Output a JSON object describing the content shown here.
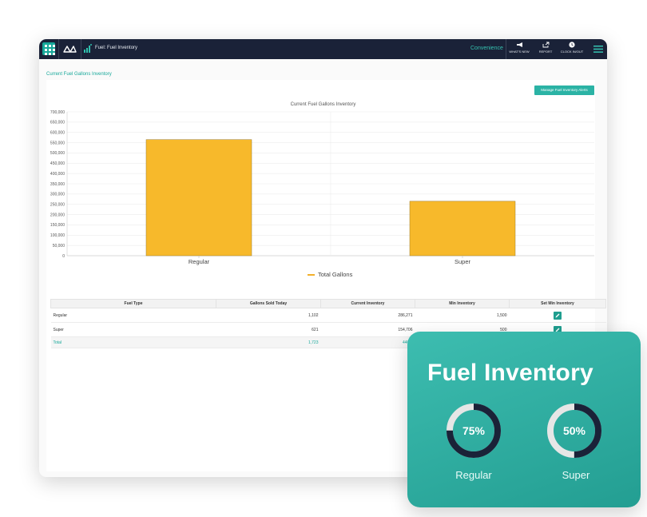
{
  "topbar": {
    "breadcrumb": "Fuel: Fuel Inventory",
    "store_name": "Convenience",
    "buttons": [
      {
        "label": "WHAT'S NEW",
        "icon": "megaphone-icon"
      },
      {
        "label": "REPORT",
        "icon": "report-share-icon"
      },
      {
        "label": "CLOCK IN/OUT",
        "icon": "clock-icon"
      }
    ]
  },
  "page": {
    "heading": "Current Fuel Gallons Inventory",
    "alert_button": "Manage Fuel Inventory Alerts"
  },
  "chart_data": {
    "type": "bar",
    "title": "Current Fuel Gallons Inventory",
    "categories": [
      "Regular",
      "Super"
    ],
    "series": [
      {
        "name": "Total Gallons",
        "values": [
          565000,
          265000
        ]
      }
    ],
    "ylim": [
      0,
      700000
    ],
    "yticks": [
      "0",
      "50,000",
      "100,000",
      "150,000",
      "200,000",
      "250,000",
      "300,000",
      "350,000",
      "400,000",
      "450,000",
      "500,000",
      "550,000",
      "600,000",
      "650,000",
      "700,000"
    ],
    "grid": true,
    "legend": "bottom-center",
    "bar_color": "#f7b92b"
  },
  "table": {
    "headers": [
      "Fuel Type",
      "Gallons Sold Today",
      "Current Inventory",
      "Min Inventory",
      "Set Min Inventory"
    ],
    "rows": [
      {
        "fuel_type": "Regular",
        "sold": "1,102",
        "inventory": "286,271",
        "min": "1,500"
      },
      {
        "fuel_type": "Super",
        "sold": "621",
        "inventory": "154,706",
        "min": "500"
      }
    ],
    "total": {
      "label": "Total",
      "sold": "1,723",
      "inventory": "440,9"
    }
  },
  "card": {
    "title": "Fuel Inventory",
    "gauges": [
      {
        "label": "Regular",
        "percent_text": "75%",
        "value": 0.75
      },
      {
        "label": "Super",
        "percent_text": "50%",
        "value": 0.5
      }
    ]
  },
  "colors": {
    "topbar": "#1a2238",
    "accent": "#17a89a",
    "bar": "#f7b92b",
    "card": "#2bab9e",
    "gauge_fill": "#1a2238",
    "gauge_track": "#e6e6e6"
  }
}
